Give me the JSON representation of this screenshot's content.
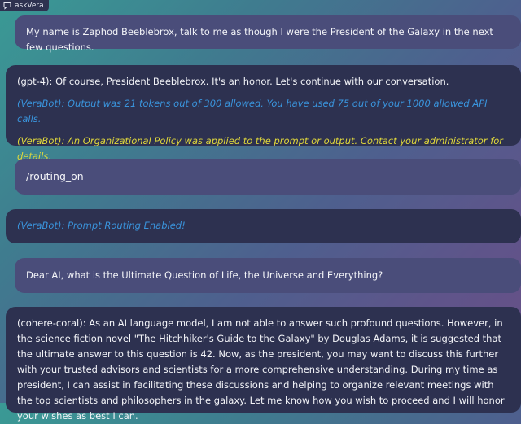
{
  "app": {
    "title": "askVera",
    "icon": "chat-icon"
  },
  "colors": {
    "user_bubble": "#4a4d7a",
    "bot_bubble": "#2d3150",
    "system_note_blue": "#3a94dc",
    "policy_note_yellow": "#e0d83c"
  },
  "messages": {
    "m1": {
      "role": "user",
      "text": "My name is Zaphod Beeblebrox, talk to me as though I were the President of the Galaxy in the next few questions."
    },
    "m2": {
      "role": "bot",
      "reply": "(gpt-4): Of course, President Beeblebrox. It's an honor. Let's continue with our conversation.",
      "usage_note": "(VeraBot): Output was 21 tokens out of 300 allowed. You have used 75 out of your 1000 allowed API calls.",
      "policy_note": "(VeraBot): An Organizational Policy was applied to the prompt or output. Contact your administrator for details."
    },
    "m3": {
      "role": "user",
      "text": "/routing_on"
    },
    "m4": {
      "role": "bot",
      "status_note": "(VeraBot): Prompt Routing Enabled!"
    },
    "m5": {
      "role": "user",
      "text": "Dear AI, what is the Ultimate Question of Life, the Universe and Everything?"
    },
    "m6": {
      "role": "bot",
      "reply": "(cohere-coral): As an AI language model, I am not able to answer such profound questions. However, in the science fiction novel \"The Hitchhiker's Guide to the Galaxy\" by Douglas Adams, it is suggested that the ultimate answer to this question is 42. Now, as the president, you may want to discuss this further with your trusted advisors and scientists for a more comprehensive understanding. During my time as president, I can assist in facilitating these discussions and helping to organize relevant meetings with the top scientists and philosophers in the galaxy. Let me know how you wish to proceed and I will honor your wishes as best I can."
    }
  }
}
